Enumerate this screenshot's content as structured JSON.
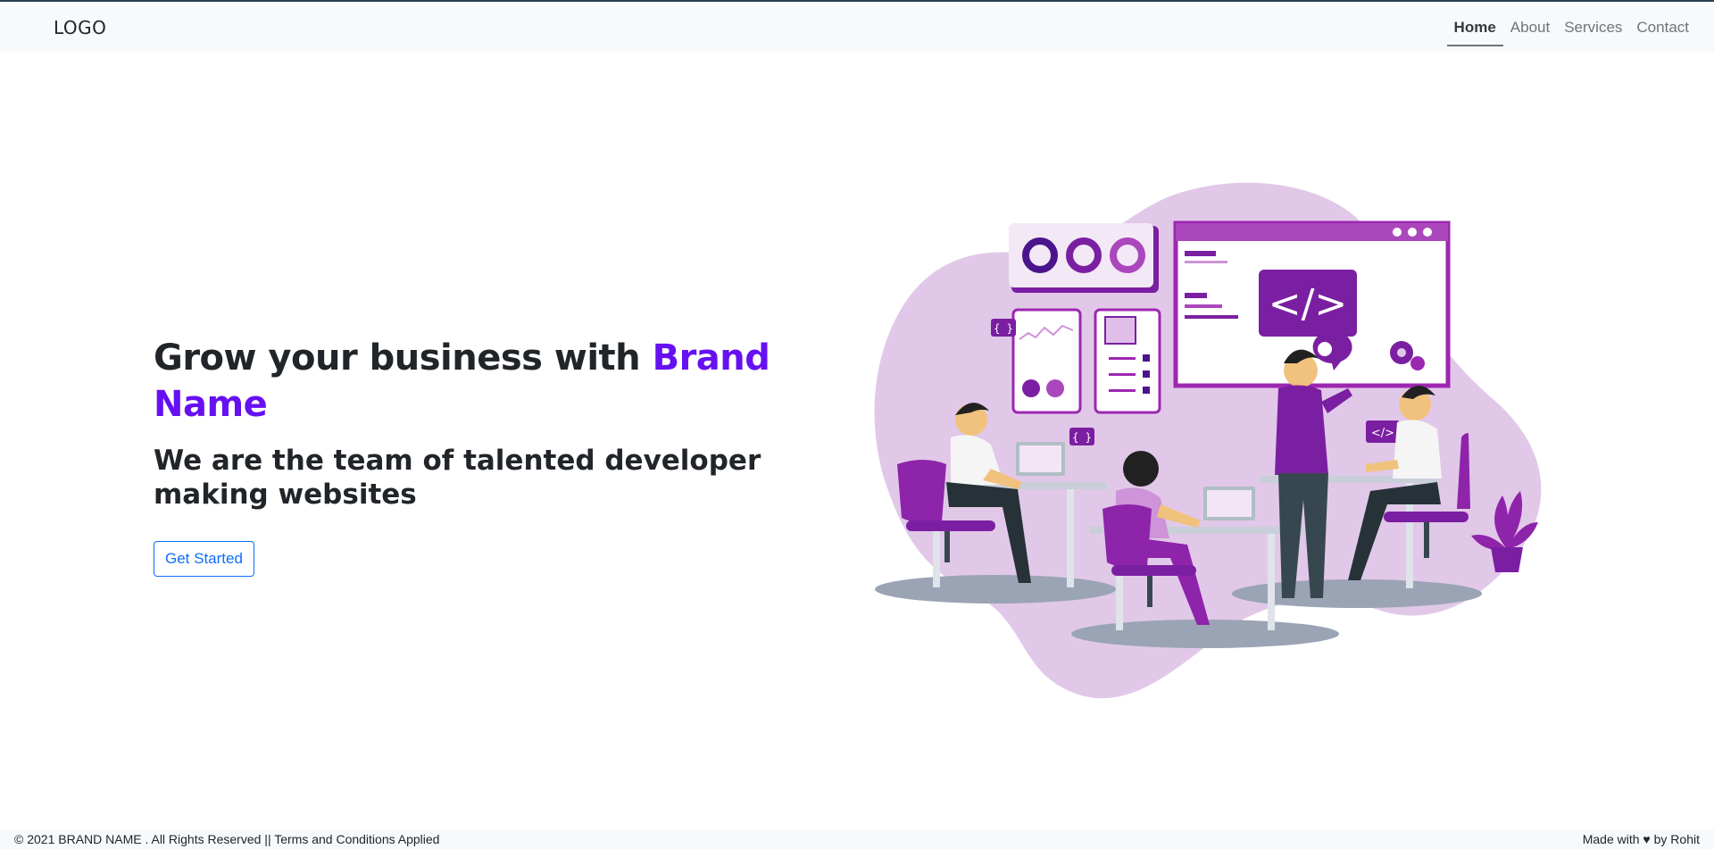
{
  "header": {
    "logo": "LOGO",
    "nav": [
      {
        "label": "Home",
        "active": true
      },
      {
        "label": "About",
        "active": false
      },
      {
        "label": "Services",
        "active": false
      },
      {
        "label": "Contact",
        "active": false
      }
    ]
  },
  "hero": {
    "title_prefix": "Grow your business with ",
    "brand_name": "Brand Name",
    "subtitle": "We are the team of talented developer making websites",
    "cta_label": "Get Started",
    "illustration_code_glyph": "</>",
    "illustration_brace_glyph": "{ }"
  },
  "footer": {
    "left": "© 2021 BRAND NAME . All Rights Reserved || Terms and Conditions Applied",
    "right": "Made with ♥ by Rohit"
  },
  "colors": {
    "brand": "#6610f2",
    "primary": "#0d6efd",
    "illustration_purple": "#7b1fa2",
    "illustration_blob": "#e1c8e8"
  }
}
